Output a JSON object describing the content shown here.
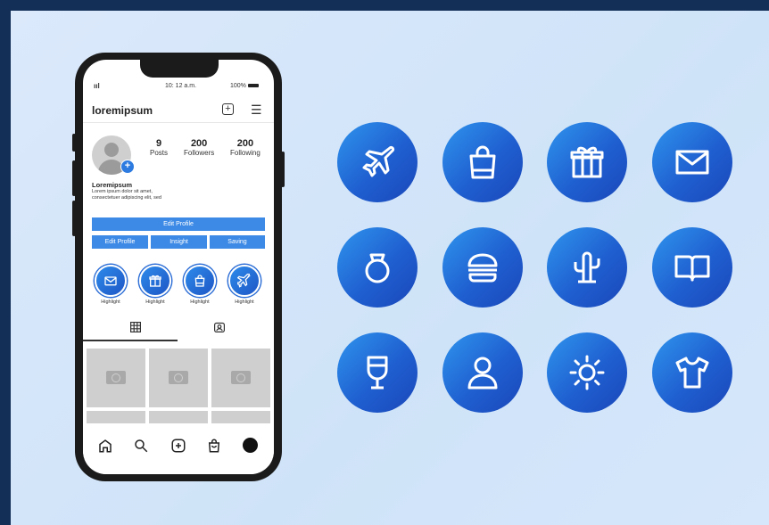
{
  "status_bar": {
    "signal": "ııl",
    "time": "10: 12 a.m.",
    "battery": "100%"
  },
  "app_bar": {
    "username_logo": "loremipsum",
    "add_icon": "plus-square-icon",
    "menu_icon": "hamburger-menu-icon"
  },
  "profile": {
    "stats": [
      {
        "value": "9",
        "label": "Posts"
      },
      {
        "value": "200",
        "label": "Followers"
      },
      {
        "value": "200",
        "label": "Following"
      }
    ],
    "name": "Loremipsum",
    "bio_line1": "Lorem ipsum dolor sit amet,",
    "bio_line2": "consectetuer adipiscing elit, sed"
  },
  "buttons": {
    "edit_profile_main": "Edit Profile",
    "edit_profile": "Edit Profile",
    "insight": "Insight",
    "saving": "Saving"
  },
  "highlights": [
    {
      "label": "Highlight",
      "icon": "mail-icon"
    },
    {
      "label": "Highlight",
      "icon": "gift-icon"
    },
    {
      "label": "Highlight",
      "icon": "shopping-bag-icon"
    },
    {
      "label": "Highlight",
      "icon": "airplane-icon"
    }
  ],
  "tabs": [
    {
      "icon": "grid-icon"
    },
    {
      "icon": "tagged-person-icon"
    }
  ],
  "bottom_nav": [
    "home-icon",
    "search-icon",
    "add-post-icon",
    "shop-icon",
    "profile-avatar-icon"
  ],
  "icon_set": [
    "airplane-icon",
    "shopping-bag-icon",
    "gift-icon",
    "mail-icon",
    "ring-icon",
    "burger-icon",
    "cactus-icon",
    "book-icon",
    "wine-glass-icon",
    "user-icon",
    "sun-icon",
    "tshirt-icon"
  ],
  "colors": {
    "accent": "#3d8ae6",
    "icon_gradient_start": "#2f95ee",
    "icon_gradient_end": "#1a47b9",
    "background": "#d6e7fb",
    "border": "#132f57"
  }
}
